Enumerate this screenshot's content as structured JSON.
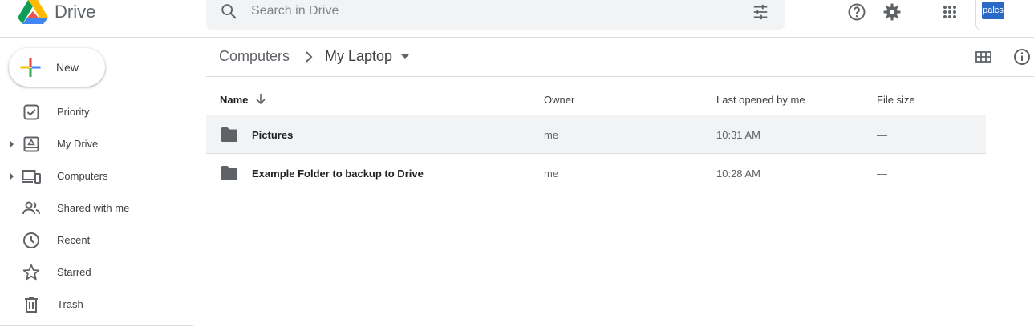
{
  "app": {
    "title": "Drive"
  },
  "search": {
    "placeholder": "Search in Drive",
    "value": ""
  },
  "account": {
    "avatar_text": "palcs"
  },
  "new_button": {
    "label": "New"
  },
  "sidebar": {
    "items": [
      {
        "label": "Priority",
        "icon": "priority-icon",
        "expandable": false
      },
      {
        "label": "My Drive",
        "icon": "my-drive-icon",
        "expandable": true
      },
      {
        "label": "Computers",
        "icon": "computers-icon",
        "expandable": true
      },
      {
        "label": "Shared with me",
        "icon": "shared-icon",
        "expandable": false
      },
      {
        "label": "Recent",
        "icon": "clock-icon",
        "expandable": false
      },
      {
        "label": "Starred",
        "icon": "star-icon",
        "expandable": false
      },
      {
        "label": "Trash",
        "icon": "trash-icon",
        "expandable": false
      }
    ]
  },
  "breadcrumb": {
    "root": "Computers",
    "current": "My Laptop"
  },
  "table": {
    "columns": {
      "name": "Name",
      "owner": "Owner",
      "last_opened": "Last opened by me",
      "file_size": "File size"
    },
    "rows": [
      {
        "name": "Pictures",
        "owner": "me",
        "last_opened": "10:31 AM",
        "file_size": "—",
        "type": "folder",
        "selected": true
      },
      {
        "name": "Example Folder to backup to Drive",
        "owner": "me",
        "last_opened": "10:28 AM",
        "file_size": "—",
        "type": "folder",
        "selected": false
      }
    ]
  },
  "colors": {
    "accent_blue": "#1a73e8",
    "icon_gray": "#5f6368",
    "selected_row": "#f1f3f4"
  }
}
